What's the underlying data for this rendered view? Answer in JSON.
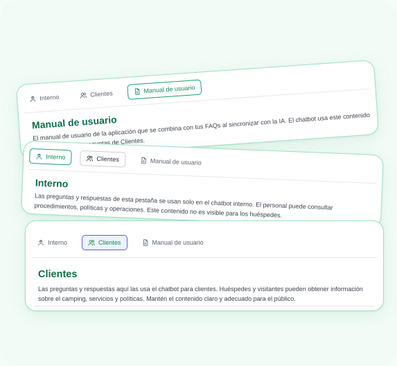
{
  "tabs": {
    "interno": "Interno",
    "clientes": "Clientes",
    "manual": "Manual de usuario"
  },
  "cards": {
    "manual": {
      "title": "Manual de usuario",
      "text": "El manual de usuario de la aplicación que se combina con tus FAQs al sincronizar con la IA. El chatbot usa este contenido para responder a preguntas de Clientes."
    },
    "interno": {
      "title": "Interno",
      "text": "Las preguntas y respuestas de esta pestaña se usan solo en el chatbot interno. El personal puede consultar procedimientos, políticas y operaciones. Este contenido no es visible para los huéspedes."
    },
    "clientes": {
      "title": "Clientes",
      "text": "Las preguntas y respuestas aquí las usa el chatbot para clientes. Huéspedes y visitantes pueden obtener información sobre el camping, servicios y políticas. Mantén el contenido claro y adecuado para el público."
    }
  },
  "colors": {
    "accent": "#16a368",
    "title": "#0d6e47",
    "blue_active": "#5b5be8"
  },
  "icons": {
    "interno": "staff-icon",
    "clientes": "users-icon",
    "manual": "document-icon"
  }
}
